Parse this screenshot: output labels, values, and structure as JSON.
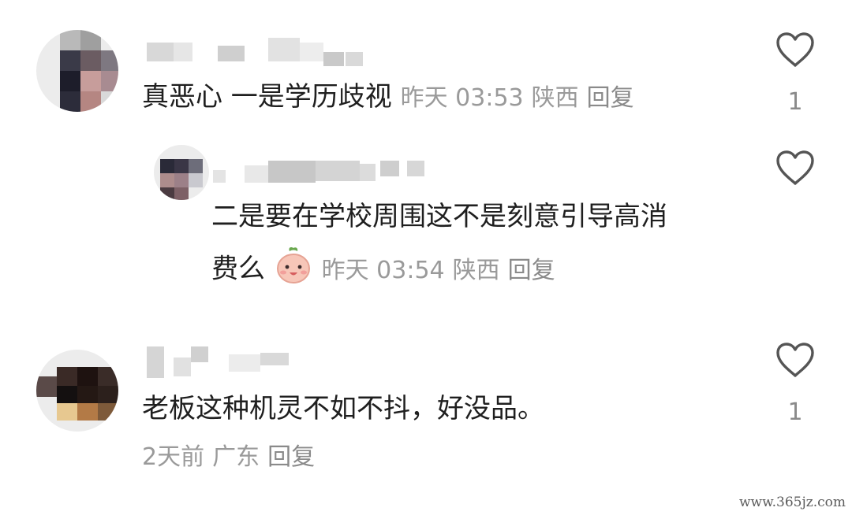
{
  "comments": [
    {
      "text": "真恶心 一是学历歧视",
      "time": "昨天 03:53",
      "location": "陕西",
      "reply_label": "回复",
      "likes": "1"
    },
    {
      "text": "二是要在学校周围这不是刻意引导高消",
      "text_line2": "费么",
      "emoji": "smiling-face-emoji",
      "time": "昨天 03:54",
      "location": "陕西",
      "reply_label": "回复"
    },
    {
      "text": "老板这种机灵不如不抖，好没品。",
      "time": "2天前",
      "location": "广东",
      "reply_label": "回复",
      "likes": "1"
    }
  ],
  "watermark": "www.365jz.com",
  "colors": {
    "meta_text": "#9a9a9a",
    "body_text": "#1f1f1f",
    "heart_outline": "#555555"
  }
}
